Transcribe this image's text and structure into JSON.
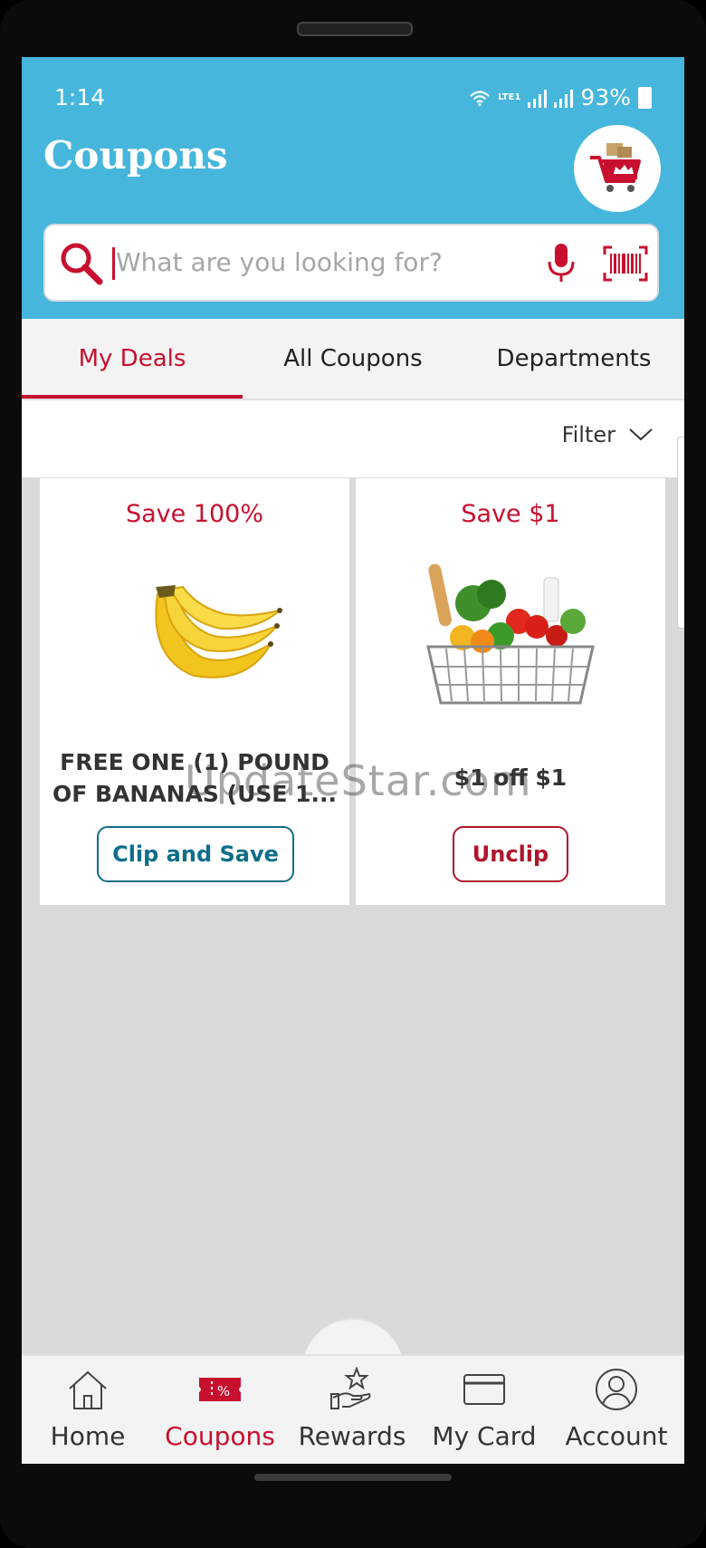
{
  "status_bar": {
    "time": "1:14",
    "network": "LTE1",
    "battery": "93%"
  },
  "header": {
    "title": "Coupons",
    "cart_icon": "cart-icon"
  },
  "search": {
    "placeholder": "What are you looking for?",
    "value": ""
  },
  "tabs": [
    {
      "label": "My Deals",
      "active": true
    },
    {
      "label": "All Coupons",
      "active": false
    },
    {
      "label": "Departments",
      "active": false
    }
  ],
  "filter": {
    "label": "Filter"
  },
  "coupons": [
    {
      "save": "Save 100%",
      "title": "FREE ONE (1) POUND OF BANANAS (USE 1...",
      "button": "Clip and Save",
      "image": "bananas-image"
    },
    {
      "save": "Save $1",
      "title": "$1 off $1",
      "button": "Unclip",
      "image": "grocery-basket-image"
    }
  ],
  "watermark": "UpdateStar.com",
  "bottom_nav": [
    {
      "label": "Home",
      "icon": "home-icon",
      "active": false
    },
    {
      "label": "Coupons",
      "icon": "coupon-icon",
      "active": true
    },
    {
      "label": "Rewards",
      "icon": "rewards-icon",
      "active": false
    },
    {
      "label": "My Card",
      "icon": "card-icon",
      "active": false
    },
    {
      "label": "Account",
      "icon": "account-icon",
      "active": false
    }
  ],
  "colors": {
    "header_bg": "#46b6dc",
    "accent": "#c8102e",
    "clip_button": "#0f6e8a"
  }
}
